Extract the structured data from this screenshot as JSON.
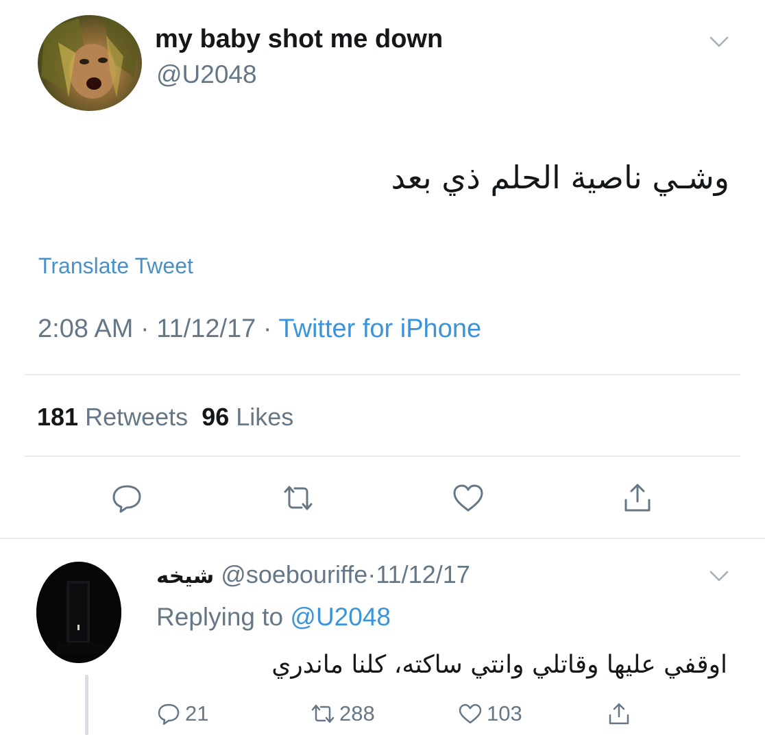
{
  "tweet": {
    "display_name": "my baby shot me down",
    "handle": "@U2048",
    "text": "وشـي ناصية الحلم ذي بعد",
    "translate_label": "Translate Tweet",
    "time": "2:08 AM",
    "date": "11/12/17",
    "separator": "·",
    "source": "Twitter for iPhone",
    "retweets_count": "181",
    "retweets_label": "Retweets",
    "likes_count": "96",
    "likes_label": "Likes"
  },
  "reply": {
    "display_name": "شيخه",
    "handle": "@soebouriffe",
    "separator": "·",
    "date": "11/12/17",
    "replying_prefix": "Replying to",
    "replying_to": "@U2048",
    "text": "اوقفي عليها وقاتلي وانتي ساكته، كلنا ماندري",
    "reply_count": "21",
    "retweet_count": "288",
    "like_count": "103"
  },
  "icons": {
    "caret": "chevron-down-icon",
    "reply": "reply-icon",
    "retweet": "retweet-icon",
    "like": "heart-icon",
    "share": "share-icon"
  },
  "colors": {
    "text_primary": "#14171a",
    "text_secondary": "#657786",
    "link_blue": "#3b94d9",
    "divider": "#e6ecf0"
  }
}
